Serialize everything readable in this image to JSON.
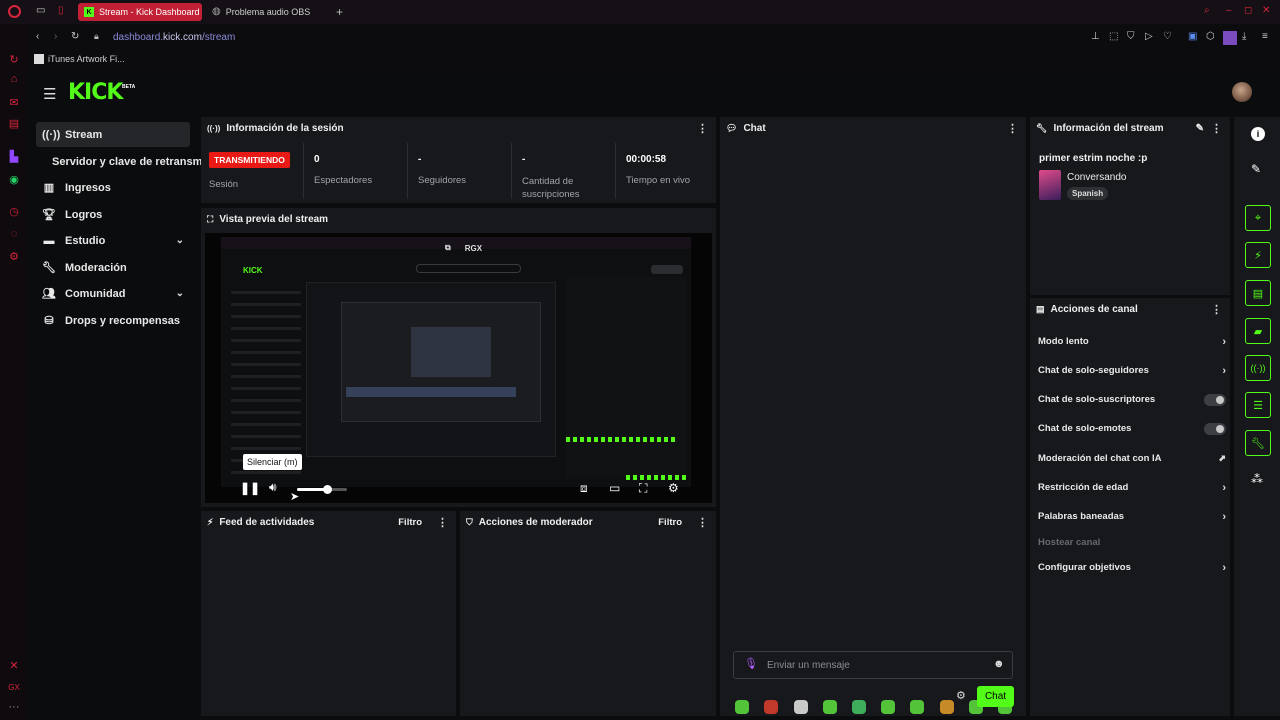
{
  "browser": {
    "tabs": [
      {
        "label": "Stream - Kick Dashboard"
      },
      {
        "label": "Problema audio OBS"
      }
    ],
    "new_tab": "+",
    "url_host": "dashboard.",
    "url_domain": "kick.com",
    "url_path": "/stream",
    "bookmark": "iTunes Artwork Fi..."
  },
  "brand": {
    "logo": "KICK",
    "beta": "BETA"
  },
  "nav": {
    "items": [
      {
        "label": "Stream",
        "icon": "broadcast-icon"
      },
      {
        "label": "Servidor y clave de retransm",
        "icon": ""
      },
      {
        "label": "Ingresos",
        "icon": "chart-icon"
      },
      {
        "label": "Logros",
        "icon": "trophy-icon"
      },
      {
        "label": "Estudio",
        "icon": "studio-icon"
      },
      {
        "label": "Moderación",
        "icon": "wrench-icon"
      },
      {
        "label": "Comunidad",
        "icon": "community-icon"
      },
      {
        "label": "Drops y recompensas",
        "icon": "drops-icon"
      }
    ]
  },
  "session": {
    "title": "Información de la sesión",
    "live_badge": "TRANSMITIENDO",
    "session_label": "Sesión",
    "stats": [
      {
        "value": "0",
        "label": "Espectadores"
      },
      {
        "value": "-",
        "label": "Seguidores"
      },
      {
        "value": "-",
        "label": "Cantidad de suscripciones"
      },
      {
        "value": "00:00:58",
        "label": "Tiempo en vivo"
      }
    ]
  },
  "preview": {
    "title": "Vista previa del stream",
    "tooltip": "Silenciar (m)",
    "volume": 0.6,
    "overlay_label": "RGX"
  },
  "activity": {
    "title": "Feed de actividades",
    "filter": "Filtro"
  },
  "modactions": {
    "title": "Acciones de moderador",
    "filter": "Filtro"
  },
  "chat": {
    "title": "Chat",
    "placeholder": "Enviar un mensaje",
    "send_label": "Chat"
  },
  "stream_info": {
    "title": "Información del stream",
    "stream_title": "primer estrim noche :p",
    "category": "Conversando",
    "language": "Spanish"
  },
  "channel_actions": {
    "title": "Acciones de canal",
    "rows": [
      {
        "label": "Modo lento",
        "control": "arrow"
      },
      {
        "label": "Chat de solo-seguidores",
        "control": "arrow"
      },
      {
        "label": "Chat de solo-suscriptores",
        "control": "toggle"
      },
      {
        "label": "Chat de solo-emotes",
        "control": "toggle"
      },
      {
        "label": "Moderación del chat con IA",
        "control": "external"
      },
      {
        "label": "Restricción de edad",
        "control": "arrow"
      },
      {
        "label": "Palabras baneadas",
        "control": "arrow"
      },
      {
        "label": "Hostear canal",
        "control": "none"
      },
      {
        "label": "Configurar objetivos",
        "control": "arrow"
      }
    ]
  },
  "colors": {
    "accent": "#53fc18",
    "live": "#e91916",
    "opera": "#d8243c"
  }
}
